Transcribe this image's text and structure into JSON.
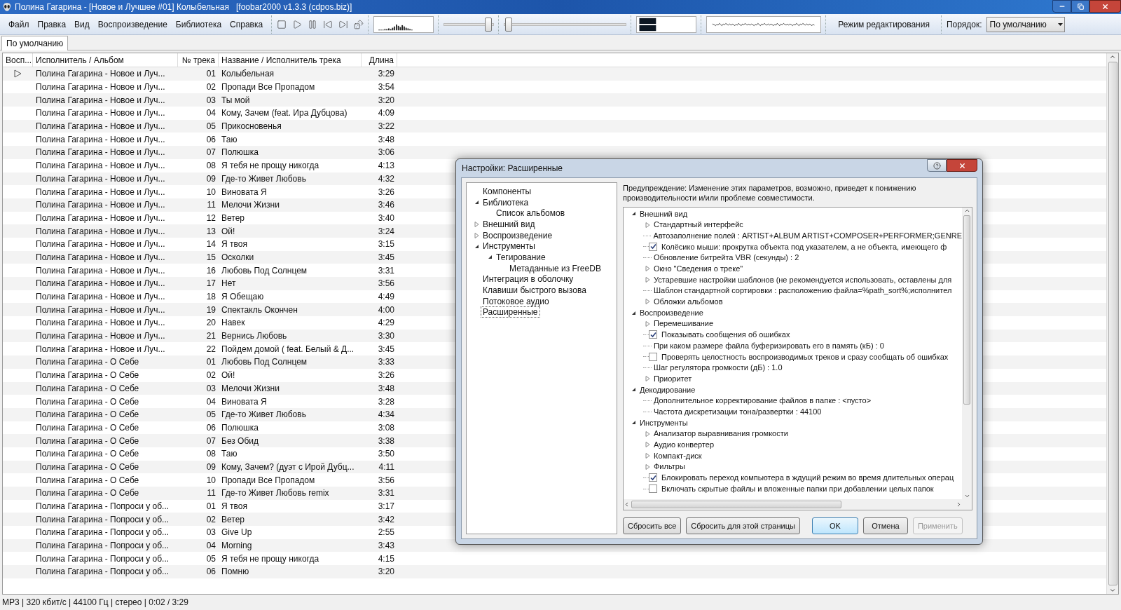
{
  "window": {
    "title": "Полина Гагарина - [Новое и Лучшее #01] Колыбельная   [foobar2000 v1.3.3 (cdpos.biz)]"
  },
  "menu": [
    "Файл",
    "Правка",
    "Вид",
    "Воспроизведение",
    "Библиотека",
    "Справка"
  ],
  "toolbar": {
    "volume": {
      "level": 0.95
    },
    "seek": {
      "level": 0.01
    },
    "edit_mode": "Режим редактирования",
    "order_label": "Порядок:",
    "order_value": "По умолчанию"
  },
  "tabs": [
    {
      "label": "По умолчанию",
      "selected": true
    }
  ],
  "playlist": {
    "columns": [
      "Восп...",
      "Исполнитель / Альбом",
      "№ трека",
      "Название / Исполнитель трека",
      "Длина"
    ],
    "rows": [
      {
        "playing": true,
        "album": "Полина Гагарина - Новое и Луч...",
        "track": "01",
        "title": "Колыбельная",
        "length": "3:29"
      },
      {
        "playing": false,
        "album": "Полина Гагарина - Новое и Луч...",
        "track": "02",
        "title": "Пропади Все Пропадом",
        "length": "3:54"
      },
      {
        "playing": false,
        "album": "Полина Гагарина - Новое и Луч...",
        "track": "03",
        "title": "Ты мой",
        "length": "3:20"
      },
      {
        "playing": false,
        "album": "Полина Гагарина - Новое и Луч...",
        "track": "04",
        "title": "Кому, Зачем (feat. Ира Дубцова)",
        "length": "4:09"
      },
      {
        "playing": false,
        "album": "Полина Гагарина - Новое и Луч...",
        "track": "05",
        "title": "Прикосновенья",
        "length": "3:22"
      },
      {
        "playing": false,
        "album": "Полина Гагарина - Новое и Луч...",
        "track": "06",
        "title": "Таю",
        "length": "3:48"
      },
      {
        "playing": false,
        "album": "Полина Гагарина - Новое и Луч...",
        "track": "07",
        "title": "Полюшка",
        "length": "3:06"
      },
      {
        "playing": false,
        "album": "Полина Гагарина - Новое и Луч...",
        "track": "08",
        "title": "Я тебя не прощу никогда",
        "length": "4:13"
      },
      {
        "playing": false,
        "album": "Полина Гагарина - Новое и Луч...",
        "track": "09",
        "title": "Где-то Живет Любовь",
        "length": "4:32"
      },
      {
        "playing": false,
        "album": "Полина Гагарина - Новое и Луч...",
        "track": "10",
        "title": "Виновата Я",
        "length": "3:26"
      },
      {
        "playing": false,
        "album": "Полина Гагарина - Новое и Луч...",
        "track": "11",
        "title": "Мелочи Жизни",
        "length": "3:46"
      },
      {
        "playing": false,
        "album": "Полина Гагарина - Новое и Луч...",
        "track": "12",
        "title": "Ветер",
        "length": "3:40"
      },
      {
        "playing": false,
        "album": "Полина Гагарина - Новое и Луч...",
        "track": "13",
        "title": "Ой!",
        "length": "3:24"
      },
      {
        "playing": false,
        "album": "Полина Гагарина - Новое и Луч...",
        "track": "14",
        "title": "Я твоя",
        "length": "3:15"
      },
      {
        "playing": false,
        "album": "Полина Гагарина - Новое и Луч...",
        "track": "15",
        "title": "Осколки",
        "length": "3:45"
      },
      {
        "playing": false,
        "album": "Полина Гагарина - Новое и Луч...",
        "track": "16",
        "title": "Любовь Под Солнцем",
        "length": "3:31"
      },
      {
        "playing": false,
        "album": "Полина Гагарина - Новое и Луч...",
        "track": "17",
        "title": "Нет",
        "length": "3:56"
      },
      {
        "playing": false,
        "album": "Полина Гагарина - Новое и Луч...",
        "track": "18",
        "title": "Я Обещаю",
        "length": "4:49"
      },
      {
        "playing": false,
        "album": "Полина Гагарина - Новое и Луч...",
        "track": "19",
        "title": "Спектакль Окончен",
        "length": "4:00"
      },
      {
        "playing": false,
        "album": "Полина Гагарина - Новое и Луч...",
        "track": "20",
        "title": "Навек",
        "length": "4:29"
      },
      {
        "playing": false,
        "album": "Полина Гагарина - Новое и Луч...",
        "track": "21",
        "title": "Вернись Любовь",
        "length": "3:30"
      },
      {
        "playing": false,
        "album": "Полина Гагарина - Новое и Луч...",
        "track": "22",
        "title": "Пойдем домой ( feat. Белый & Д...",
        "length": "3:45"
      },
      {
        "playing": false,
        "album": "Полина Гагарина - О Себе",
        "track": "01",
        "title": "Любовь Под Солнцем",
        "length": "3:33"
      },
      {
        "playing": false,
        "album": "Полина Гагарина - О Себе",
        "track": "02",
        "title": "Ой!",
        "length": "3:26"
      },
      {
        "playing": false,
        "album": "Полина Гагарина - О Себе",
        "track": "03",
        "title": "Мелочи Жизни",
        "length": "3:48"
      },
      {
        "playing": false,
        "album": "Полина Гагарина - О Себе",
        "track": "04",
        "title": "Виновата Я",
        "length": "3:28"
      },
      {
        "playing": false,
        "album": "Полина Гагарина - О Себе",
        "track": "05",
        "title": "Где-то Живет Любовь",
        "length": "4:34"
      },
      {
        "playing": false,
        "album": "Полина Гагарина - О Себе",
        "track": "06",
        "title": "Полюшка",
        "length": "3:08"
      },
      {
        "playing": false,
        "album": "Полина Гагарина - О Себе",
        "track": "07",
        "title": "Без Обид",
        "length": "3:38"
      },
      {
        "playing": false,
        "album": "Полина Гагарина - О Себе",
        "track": "08",
        "title": "Таю",
        "length": "3:50"
      },
      {
        "playing": false,
        "album": "Полина Гагарина - О Себе",
        "track": "09",
        "title": "Кому, Зачем? (дуэт с Ирой Дубц...",
        "length": "4:11"
      },
      {
        "playing": false,
        "album": "Полина Гагарина - О Себе",
        "track": "10",
        "title": "Пропади Все Пропадом",
        "length": "3:56"
      },
      {
        "playing": false,
        "album": "Полина Гагарина - О Себе",
        "track": "11",
        "title": "Где-то Живет Любовь remix",
        "length": "3:31"
      },
      {
        "playing": false,
        "album": "Полина Гагарина - Попроси у об...",
        "track": "01",
        "title": "Я твоя",
        "length": "3:17"
      },
      {
        "playing": false,
        "album": "Полина Гагарина - Попроси у об...",
        "track": "02",
        "title": "Ветер",
        "length": "3:42"
      },
      {
        "playing": false,
        "album": "Полина Гагарина - Попроси у об...",
        "track": "03",
        "title": "Give Up",
        "length": "2:55"
      },
      {
        "playing": false,
        "album": "Полина Гагарина - Попроси у об...",
        "track": "04",
        "title": "Morning",
        "length": "3:43"
      },
      {
        "playing": false,
        "album": "Полина Гагарина - Попроси у об...",
        "track": "05",
        "title": "Я тебя не прощу никогда",
        "length": "4:15"
      },
      {
        "playing": false,
        "album": "Полина Гагарина - Попроси у об...",
        "track": "06",
        "title": "Помню",
        "length": "3:20"
      }
    ]
  },
  "status_bar": "MP3 | 320 кбит/с | 44100 Гц | стерео | 0:02 / 3:29",
  "dialog": {
    "title": "Настройки: Расширенные",
    "nav": [
      {
        "label": "Компоненты",
        "selected": false
      },
      {
        "label": "Библиотека",
        "selected": false,
        "expanded": true,
        "children": [
          {
            "label": "Список альбомов",
            "selected": false
          }
        ]
      },
      {
        "label": "Внешний вид",
        "selected": false,
        "expanded": false
      },
      {
        "label": "Воспроизведение",
        "selected": false,
        "expanded": false
      },
      {
        "label": "Инструменты",
        "selected": false,
        "expanded": true,
        "children": [
          {
            "label": "Тегирование",
            "selected": false,
            "expanded": true,
            "children": [
              {
                "label": "Метаданные из FreeDB",
                "selected": false
              }
            ]
          }
        ]
      },
      {
        "label": "Интеграция в оболочку",
        "selected": false
      },
      {
        "label": "Клавиши быстрого вызова",
        "selected": false
      },
      {
        "label": "Потоковое аудио",
        "selected": false
      },
      {
        "label": "Расширенные",
        "selected": true
      }
    ],
    "warning": "Предупреждение: Изменение этих параметров, возможно, приведет к понижению производительности и/или проблеме совместимости.",
    "settings": [
      {
        "kind": "branch",
        "label": "Внешний вид",
        "expanded": true,
        "children": [
          {
            "kind": "branch",
            "label": "Стандартный интерфейс",
            "expanded": false
          },
          {
            "kind": "leaf",
            "label": "Автозаполнение полей : ARTIST+ALBUM ARTIST+COMPOSER+PERFORMER;GENRE"
          },
          {
            "kind": "checkbox",
            "label": "Колёсико мыши: прокрутка объекта под указателем, а не объекта, имеющего ф",
            "checked": true
          },
          {
            "kind": "leaf",
            "label": "Обновление битрейта VBR (секунды) : 2"
          },
          {
            "kind": "branch",
            "label": "Окно \"Сведения о треке\"",
            "expanded": false
          },
          {
            "kind": "branch",
            "label": "Устаревшие настройки шаблонов (не рекомендуется использовать, оставлены для",
            "expanded": false
          },
          {
            "kind": "leaf",
            "label": "Шаблон стандартной сортировки : расположению файла=%path_sort%;исполнител"
          },
          {
            "kind": "branch",
            "label": "Обложки альбомов",
            "expanded": false
          }
        ]
      },
      {
        "kind": "branch",
        "label": "Воспроизведение",
        "expanded": true,
        "children": [
          {
            "kind": "branch",
            "label": "Перемешивание",
            "expanded": false
          },
          {
            "kind": "checkbox",
            "label": "Показывать сообщения об ошибках",
            "checked": true
          },
          {
            "kind": "leaf",
            "label": "При каком размере файла буферизировать его в память (кБ) : 0"
          },
          {
            "kind": "checkbox",
            "label": "Проверять целостность воспроизводимых треков и сразу сообщать об ошибках",
            "checked": false
          },
          {
            "kind": "leaf",
            "label": "Шаг регулятора громкости (дБ) : 1.0"
          },
          {
            "kind": "branch",
            "label": "Приоритет",
            "expanded": false
          }
        ]
      },
      {
        "kind": "branch",
        "label": "Декодирование",
        "expanded": true,
        "children": [
          {
            "kind": "leaf",
            "label": "Дополнительное корректирование файлов в папке : <пусто>"
          },
          {
            "kind": "leaf",
            "label": "Частота дискретизации тона/развертки : 44100"
          }
        ]
      },
      {
        "kind": "branch",
        "label": "Инструменты",
        "expanded": true,
        "children": [
          {
            "kind": "branch",
            "label": "Анализатор выравнивания громкости",
            "expanded": false
          },
          {
            "kind": "branch",
            "label": "Аудио конвертер",
            "expanded": false
          },
          {
            "kind": "branch",
            "label": "Компакт-диск",
            "expanded": false
          },
          {
            "kind": "branch",
            "label": "Фильтры",
            "expanded": false
          },
          {
            "kind": "checkbox",
            "label": "Блокировать переход компьютера в ждущий режим во время длительных операц",
            "checked": true
          },
          {
            "kind": "checkbox",
            "label": "Включать скрытые файлы и вложенные папки при добавлении целых папок",
            "checked": false
          }
        ]
      }
    ],
    "buttons": [
      {
        "label": "Сбросить все",
        "default": false,
        "disabled": false
      },
      {
        "label": "Сбросить для этой страницы",
        "default": false,
        "disabled": false
      },
      {
        "label": "OK",
        "default": true,
        "disabled": false
      },
      {
        "label": "Отмена",
        "default": false,
        "disabled": false
      },
      {
        "label": "Применить",
        "default": false,
        "disabled": true
      }
    ]
  }
}
